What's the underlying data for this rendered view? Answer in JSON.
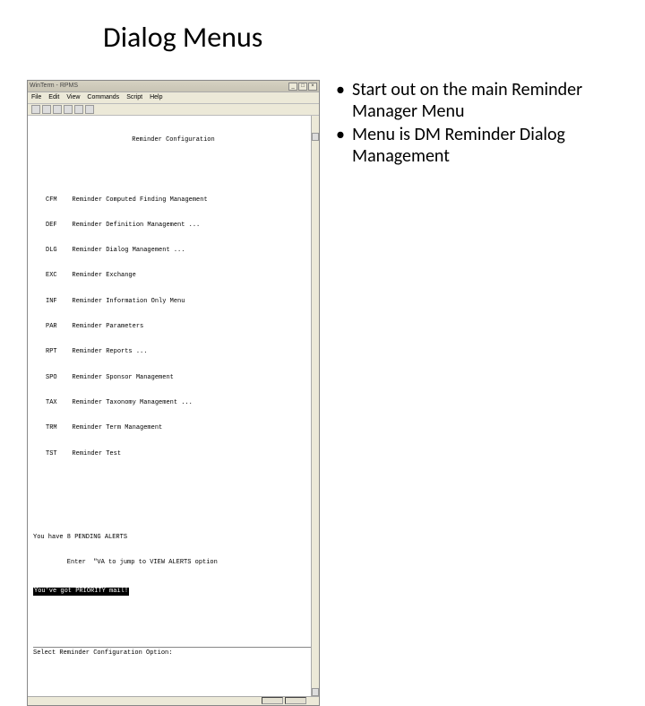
{
  "slide": {
    "title": "Dialog Menus"
  },
  "terminal": {
    "window_title": "WinTerm - RPMS",
    "menu_bar": [
      "File",
      "Edit",
      "View",
      "Commands",
      "Script",
      "Help"
    ],
    "heading": "Reminder Configuration",
    "menu_items": [
      {
        "code": "CFM",
        "label": "Reminder Computed Finding Management"
      },
      {
        "code": "DEF",
        "label": "Reminder Definition Management ..."
      },
      {
        "code": "DLG",
        "label": "Reminder Dialog Management ..."
      },
      {
        "code": "EXC",
        "label": "Reminder Exchange"
      },
      {
        "code": "INF",
        "label": "Reminder Information Only Menu"
      },
      {
        "code": "PAR",
        "label": "Reminder Parameters"
      },
      {
        "code": "RPT",
        "label": "Reminder Reports ..."
      },
      {
        "code": "SPO",
        "label": "Reminder Sponsor Management"
      },
      {
        "code": "TAX",
        "label": "Reminder Taxonomy Management ..."
      },
      {
        "code": "TRM",
        "label": "Reminder Term Management"
      },
      {
        "code": "TST",
        "label": "Reminder Test"
      }
    ],
    "alerts_line1": "You have 8 PENDING ALERTS",
    "alerts_line2": "         Enter  \"VA to jump to VIEW ALERTS option",
    "priority_mail": "You've got PRIORITY mail!",
    "prompt": "Select Reminder Configuration Option:"
  },
  "bullets": [
    "Start out on the main Reminder Manager Menu",
    "Menu is DM  Reminder Dialog Management"
  ]
}
